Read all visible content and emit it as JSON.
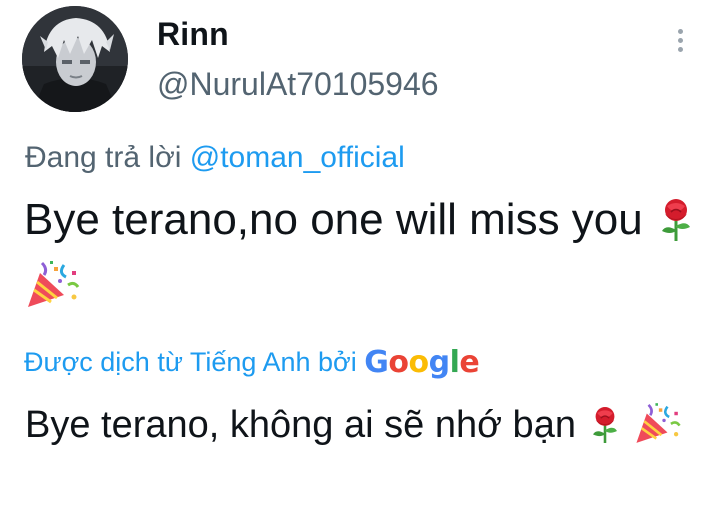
{
  "author": {
    "display_name": "Rinn",
    "handle": "@NurulAt70105946"
  },
  "reply": {
    "prefix": "Đang trả lời",
    "mention": "@toman_official"
  },
  "tweet": {
    "text": "Bye terano,no one will miss you",
    "emojis": [
      "rose-icon",
      "party-popper-icon"
    ]
  },
  "translation": {
    "label": "Được dịch từ Tiếng Anh bởi",
    "provider": "Google",
    "text": "Bye terano, không ai sẽ nhớ bạn"
  },
  "colors": {
    "link": "#1d9bf0",
    "secondary": "#536471",
    "primary_text": "#0f1419",
    "google_blue": "#4285F4",
    "google_red": "#EA4335",
    "google_yellow": "#FBBC05",
    "google_green": "#34A853"
  }
}
